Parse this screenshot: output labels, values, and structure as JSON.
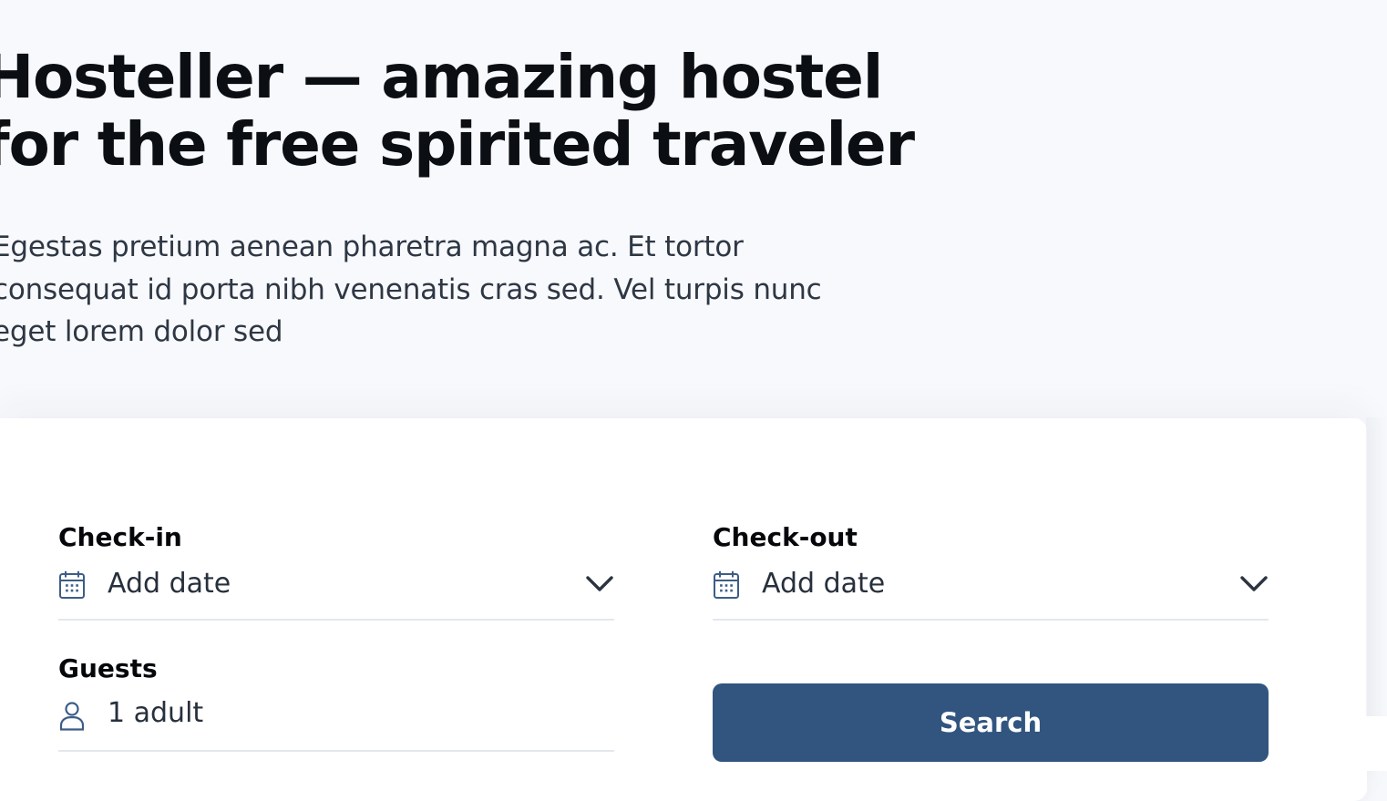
{
  "hero": {
    "title_line_1": "Hosteller — amazing hostel",
    "title_line_2": "for the free spirited traveler",
    "description_line_1": "Egestas pretium aenean pharetra magna ac. Et tortor",
    "description_line_2": "consequat id porta nibh venenatis cras sed. Vel turpis nunc",
    "description_line_3": "eget lorem dolor sed"
  },
  "search_form": {
    "checkin": {
      "label": "Check-in",
      "value": "Add date",
      "icon": "calendar-icon",
      "toggle_icon": "chevron-down-icon"
    },
    "checkout": {
      "label": "Check-out",
      "value": "Add date",
      "icon": "calendar-icon",
      "toggle_icon": "chevron-down-icon"
    },
    "guests": {
      "label": "Guests",
      "value": "1 adult",
      "icon": "user-icon"
    },
    "search_button_label": "Search"
  },
  "colors": {
    "page_background": "#f8f9fc",
    "card_background": "#ffffff",
    "primary_button": "#31557f",
    "icon_blue": "#3d5d86",
    "divider": "#e3e8ef",
    "heading_text": "#0b0f14",
    "body_text": "#2e3744"
  }
}
